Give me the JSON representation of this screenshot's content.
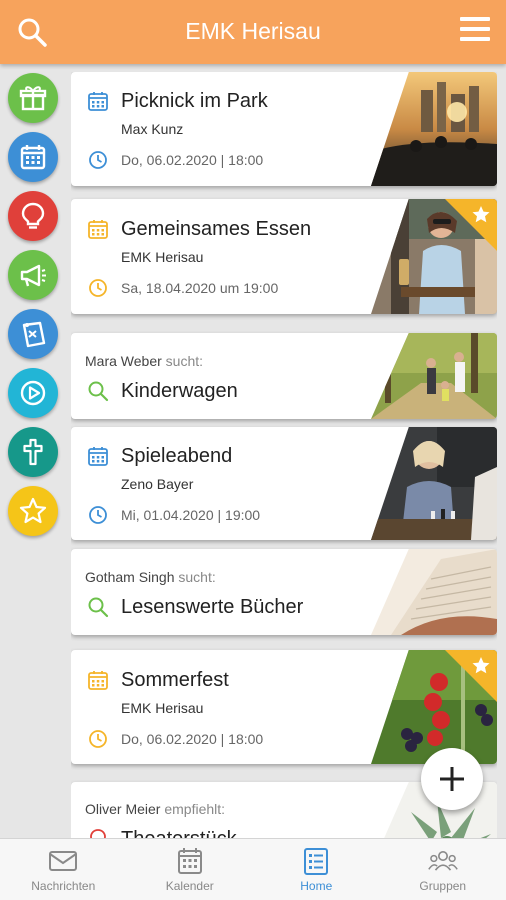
{
  "header": {
    "title": "EMK Herisau",
    "search_icon": "search-icon",
    "menu_icon": "hamburger-menu-icon"
  },
  "side_categories": [
    {
      "icon": "gift-icon",
      "color": "#6cc04a"
    },
    {
      "icon": "calendar-icon",
      "color": "#3d8fd6"
    },
    {
      "icon": "lightbulb-icon",
      "color": "#e0403a"
    },
    {
      "icon": "megaphone-icon",
      "color": "#6cc04a"
    },
    {
      "icon": "note-icon",
      "color": "#3d8fd6"
    },
    {
      "icon": "play-icon",
      "color": "#22b5d6"
    },
    {
      "icon": "cross-icon",
      "color": "#16988a"
    },
    {
      "icon": "star-icon",
      "color": "#f5c518"
    }
  ],
  "cards": [
    {
      "type": "event",
      "title": "Picknick im Park",
      "author": "Max Kunz",
      "date": "Do, 06.02.2020 | 18:00",
      "accent": "#3d8fd6",
      "featured": false
    },
    {
      "type": "event",
      "title": "Gemeinsames Essen",
      "author": "EMK Herisau",
      "date": "Sa, 18.04.2020 um 19:00",
      "accent": "#f5b52a",
      "featured": true
    },
    {
      "type": "search",
      "user": "Mara Weber",
      "verb": "sucht:",
      "title": "Kinderwagen",
      "accent": "#6cc04a"
    },
    {
      "type": "event",
      "title": "Spieleabend",
      "author": "Zeno Bayer",
      "date": "Mi, 01.04.2020 | 19:00",
      "accent": "#3d8fd6",
      "featured": false
    },
    {
      "type": "search",
      "user": "Gotham Singh",
      "verb": "sucht:",
      "title": "Lesenswerte Bücher",
      "accent": "#6cc04a"
    },
    {
      "type": "event",
      "title": "Sommerfest",
      "author": "EMK Herisau",
      "date": "Do, 06.02.2020 | 18:00",
      "accent": "#f5b52a",
      "featured": true
    },
    {
      "type": "recommend",
      "user": "Oliver Meier",
      "verb": "empfiehlt:",
      "title": "Theaterstück",
      "accent": "#e0403a"
    }
  ],
  "fab": {
    "icon": "plus-icon"
  },
  "nav": [
    {
      "label": "Nachrichten",
      "icon": "envelope-icon",
      "active": false
    },
    {
      "label": "Kalender",
      "icon": "calendar-icon",
      "active": false
    },
    {
      "label": "Home",
      "icon": "home-list-icon",
      "active": true
    },
    {
      "label": "Gruppen",
      "icon": "people-icon",
      "active": false
    }
  ]
}
